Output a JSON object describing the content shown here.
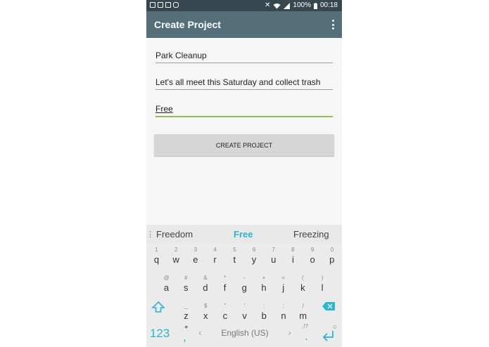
{
  "statusbar": {
    "battery": "100%",
    "time": "00:18"
  },
  "appbar": {
    "title": "Create Project"
  },
  "form": {
    "name": "Park Cleanup",
    "description": "Let's all meet this Saturday and collect trash",
    "price": "Free",
    "button_label": "CREATE PROJECT"
  },
  "suggestions": [
    "Freedom",
    "Free",
    "Freezing"
  ],
  "keyboard": {
    "row1": [
      {
        "k": "q",
        "h": "1"
      },
      {
        "k": "w",
        "h": "2"
      },
      {
        "k": "e",
        "h": "3"
      },
      {
        "k": "r",
        "h": "4"
      },
      {
        "k": "t",
        "h": "5"
      },
      {
        "k": "y",
        "h": "6"
      },
      {
        "k": "u",
        "h": "7"
      },
      {
        "k": "i",
        "h": "8"
      },
      {
        "k": "o",
        "h": "9"
      },
      {
        "k": "p",
        "h": "0"
      }
    ],
    "row2": [
      {
        "k": "a",
        "h": "@"
      },
      {
        "k": "s",
        "h": "#"
      },
      {
        "k": "d",
        "h": "&"
      },
      {
        "k": "f",
        "h": "*"
      },
      {
        "k": "g",
        "h": "-"
      },
      {
        "k": "h",
        "h": "+"
      },
      {
        "k": "j",
        "h": "="
      },
      {
        "k": "k",
        "h": "("
      },
      {
        "k": "l",
        "h": ")"
      }
    ],
    "row3": [
      {
        "k": "z",
        "h": "_"
      },
      {
        "k": "x",
        "h": "$"
      },
      {
        "k": "c",
        "h": "\""
      },
      {
        "k": "v",
        "h": "'"
      },
      {
        "k": "b",
        "h": ":"
      },
      {
        "k": "n",
        "h": ";"
      },
      {
        "k": "m",
        "h": "/"
      }
    ],
    "numbers_key": "123",
    "comma": ",",
    "space_label": "English (US)",
    "period": ".",
    "period_hint": ",!?",
    "accent_color": "#29b6d1"
  }
}
